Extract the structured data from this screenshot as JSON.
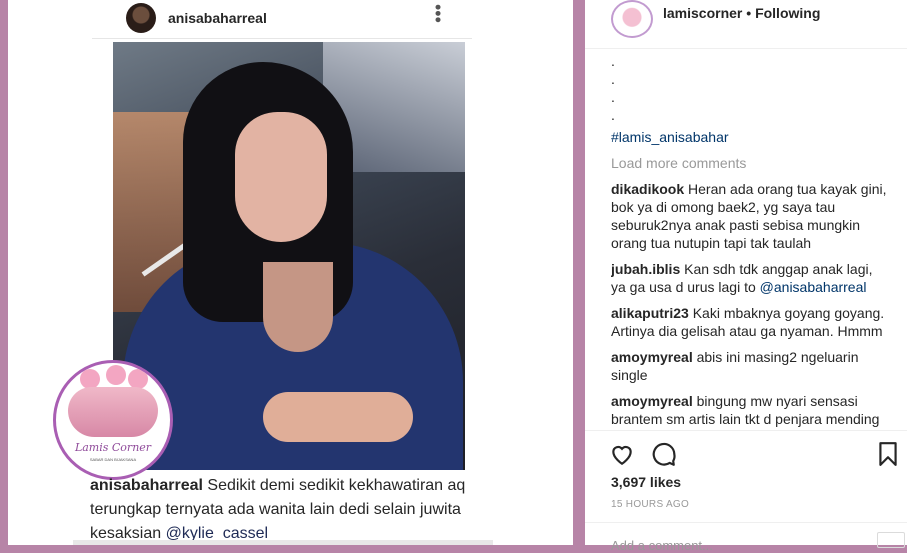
{
  "left_post": {
    "username": "anisabaharreal",
    "logo_text": "Lamis Corner",
    "logo_tagline": "SABAR DAN BIJAKSANA",
    "caption": {
      "username": "anisabaharreal",
      "text": " Sedikit demi sedikit kekhawatiran aq terungkap ternyata ada wanita lain dedi selain juwita kesaksian ",
      "mention": "@kylie_cassel"
    }
  },
  "side": {
    "username": "lamiscorner",
    "separator": " • ",
    "follow_status": "Following",
    "dots": [
      ".",
      ".",
      ".",
      "."
    ],
    "hashtag": "#lamis_anisabahar",
    "load_more": "Load more comments",
    "comments": [
      {
        "user": "dikadikook",
        "text": " Heran ada orang tua kayak gini, bok ya di omong baek2, yg saya tau seburuk2nya anak pasti sebisa mungkin orang tua nutupin tapi tak taulah",
        "mention": ""
      },
      {
        "user": "jubah.iblis",
        "text": " Kan sdh tdk anggap anak lagi, ya ga usa d urus lagi to ",
        "mention": "@anisabaharreal"
      },
      {
        "user": "alikaputri23",
        "text": " Kaki mbaknya goyang goyang. Artinya dia gelisah atau ga nyaman. Hmmm",
        "mention": ""
      },
      {
        "user": "amoymyreal",
        "text": " abis ini masing2 ngeluarin single",
        "mention": ""
      },
      {
        "user": "amoymyreal",
        "text": " bingung mw nyari sensasi brantem sm artis lain tkt d penjara mending ya ad ai d olah",
        "mention": ""
      }
    ],
    "likes": "3,697 likes",
    "time": "15 HOURS AGO",
    "add_comment_placeholder": "Add a comment..."
  },
  "colors": {
    "background": "#b784a7",
    "link": "#003569",
    "muted": "#999999"
  }
}
